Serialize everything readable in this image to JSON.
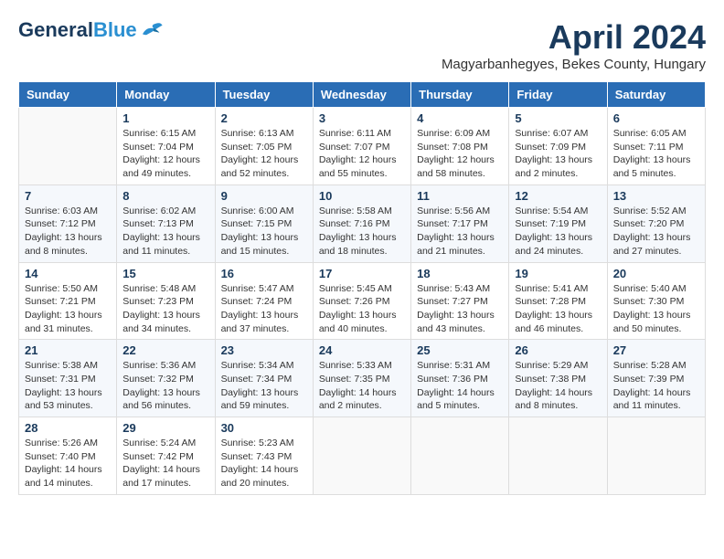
{
  "header": {
    "logo_general": "General",
    "logo_blue": "Blue",
    "month_title": "April 2024",
    "location": "Magyarbanhegyes, Bekes County, Hungary"
  },
  "days_of_week": [
    "Sunday",
    "Monday",
    "Tuesday",
    "Wednesday",
    "Thursday",
    "Friday",
    "Saturday"
  ],
  "weeks": [
    [
      {
        "day": "",
        "info": ""
      },
      {
        "day": "1",
        "info": "Sunrise: 6:15 AM\nSunset: 7:04 PM\nDaylight: 12 hours\nand 49 minutes."
      },
      {
        "day": "2",
        "info": "Sunrise: 6:13 AM\nSunset: 7:05 PM\nDaylight: 12 hours\nand 52 minutes."
      },
      {
        "day": "3",
        "info": "Sunrise: 6:11 AM\nSunset: 7:07 PM\nDaylight: 12 hours\nand 55 minutes."
      },
      {
        "day": "4",
        "info": "Sunrise: 6:09 AM\nSunset: 7:08 PM\nDaylight: 12 hours\nand 58 minutes."
      },
      {
        "day": "5",
        "info": "Sunrise: 6:07 AM\nSunset: 7:09 PM\nDaylight: 13 hours\nand 2 minutes."
      },
      {
        "day": "6",
        "info": "Sunrise: 6:05 AM\nSunset: 7:11 PM\nDaylight: 13 hours\nand 5 minutes."
      }
    ],
    [
      {
        "day": "7",
        "info": "Sunrise: 6:03 AM\nSunset: 7:12 PM\nDaylight: 13 hours\nand 8 minutes."
      },
      {
        "day": "8",
        "info": "Sunrise: 6:02 AM\nSunset: 7:13 PM\nDaylight: 13 hours\nand 11 minutes."
      },
      {
        "day": "9",
        "info": "Sunrise: 6:00 AM\nSunset: 7:15 PM\nDaylight: 13 hours\nand 15 minutes."
      },
      {
        "day": "10",
        "info": "Sunrise: 5:58 AM\nSunset: 7:16 PM\nDaylight: 13 hours\nand 18 minutes."
      },
      {
        "day": "11",
        "info": "Sunrise: 5:56 AM\nSunset: 7:17 PM\nDaylight: 13 hours\nand 21 minutes."
      },
      {
        "day": "12",
        "info": "Sunrise: 5:54 AM\nSunset: 7:19 PM\nDaylight: 13 hours\nand 24 minutes."
      },
      {
        "day": "13",
        "info": "Sunrise: 5:52 AM\nSunset: 7:20 PM\nDaylight: 13 hours\nand 27 minutes."
      }
    ],
    [
      {
        "day": "14",
        "info": "Sunrise: 5:50 AM\nSunset: 7:21 PM\nDaylight: 13 hours\nand 31 minutes."
      },
      {
        "day": "15",
        "info": "Sunrise: 5:48 AM\nSunset: 7:23 PM\nDaylight: 13 hours\nand 34 minutes."
      },
      {
        "day": "16",
        "info": "Sunrise: 5:47 AM\nSunset: 7:24 PM\nDaylight: 13 hours\nand 37 minutes."
      },
      {
        "day": "17",
        "info": "Sunrise: 5:45 AM\nSunset: 7:26 PM\nDaylight: 13 hours\nand 40 minutes."
      },
      {
        "day": "18",
        "info": "Sunrise: 5:43 AM\nSunset: 7:27 PM\nDaylight: 13 hours\nand 43 minutes."
      },
      {
        "day": "19",
        "info": "Sunrise: 5:41 AM\nSunset: 7:28 PM\nDaylight: 13 hours\nand 46 minutes."
      },
      {
        "day": "20",
        "info": "Sunrise: 5:40 AM\nSunset: 7:30 PM\nDaylight: 13 hours\nand 50 minutes."
      }
    ],
    [
      {
        "day": "21",
        "info": "Sunrise: 5:38 AM\nSunset: 7:31 PM\nDaylight: 13 hours\nand 53 minutes."
      },
      {
        "day": "22",
        "info": "Sunrise: 5:36 AM\nSunset: 7:32 PM\nDaylight: 13 hours\nand 56 minutes."
      },
      {
        "day": "23",
        "info": "Sunrise: 5:34 AM\nSunset: 7:34 PM\nDaylight: 13 hours\nand 59 minutes."
      },
      {
        "day": "24",
        "info": "Sunrise: 5:33 AM\nSunset: 7:35 PM\nDaylight: 14 hours\nand 2 minutes."
      },
      {
        "day": "25",
        "info": "Sunrise: 5:31 AM\nSunset: 7:36 PM\nDaylight: 14 hours\nand 5 minutes."
      },
      {
        "day": "26",
        "info": "Sunrise: 5:29 AM\nSunset: 7:38 PM\nDaylight: 14 hours\nand 8 minutes."
      },
      {
        "day": "27",
        "info": "Sunrise: 5:28 AM\nSunset: 7:39 PM\nDaylight: 14 hours\nand 11 minutes."
      }
    ],
    [
      {
        "day": "28",
        "info": "Sunrise: 5:26 AM\nSunset: 7:40 PM\nDaylight: 14 hours\nand 14 minutes."
      },
      {
        "day": "29",
        "info": "Sunrise: 5:24 AM\nSunset: 7:42 PM\nDaylight: 14 hours\nand 17 minutes."
      },
      {
        "day": "30",
        "info": "Sunrise: 5:23 AM\nSunset: 7:43 PM\nDaylight: 14 hours\nand 20 minutes."
      },
      {
        "day": "",
        "info": ""
      },
      {
        "day": "",
        "info": ""
      },
      {
        "day": "",
        "info": ""
      },
      {
        "day": "",
        "info": ""
      }
    ]
  ]
}
